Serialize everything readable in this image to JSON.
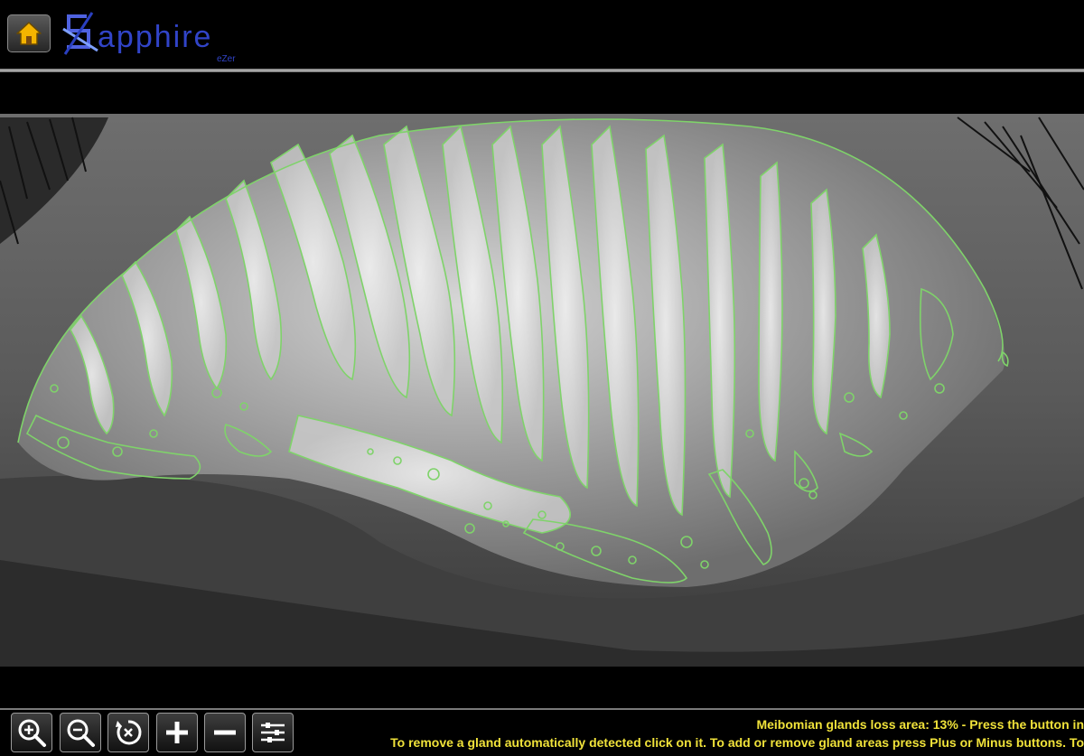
{
  "header": {
    "home_icon": "home-icon",
    "logo": {
      "text": "Sapphire",
      "subtext": "eZer",
      "color": "#2a3fbf"
    },
    "rule_color": "#b9b9b9"
  },
  "viewer": {
    "image": "meibography-infrared-eyelid",
    "overlay_color": "#7fd36a",
    "background": "#000000"
  },
  "toolbar": {
    "buttons": [
      {
        "name": "zoom-in-button",
        "icon": "zoom-in-icon"
      },
      {
        "name": "zoom-out-button",
        "icon": "zoom-out-icon"
      },
      {
        "name": "reset-button",
        "icon": "reset-icon"
      },
      {
        "name": "plus-button",
        "icon": "plus-icon"
      },
      {
        "name": "minus-button",
        "icon": "minus-icon"
      },
      {
        "name": "settings-button",
        "icon": "sliders-icon"
      }
    ],
    "status_line1": "Meibomian glands loss area: 13% - Press the button in",
    "status_line2": "To remove a gland automatically detected click on it. To add or remove gland areas press Plus or Minus buttons. To",
    "status_color": "#f0e23a"
  }
}
